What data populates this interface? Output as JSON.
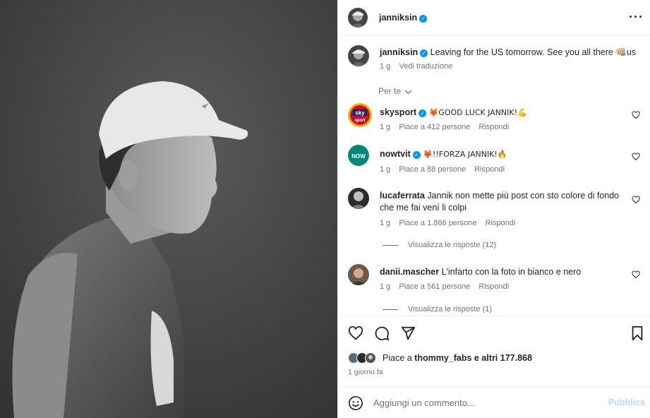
{
  "post": {
    "username": "janniksin",
    "more_icon": "more-horizontal-icon",
    "caption": {
      "username": "janniksin",
      "text": "Leaving for the US tomorrow. See you all there 👊🏼us",
      "time": "1 g",
      "translate": "Vedi traduzione"
    }
  },
  "filter": {
    "label": "Per te"
  },
  "comments": [
    {
      "username": "skysport",
      "verified": true,
      "text": "🦊GOOD LUCK JANNIK!💪",
      "time": "1 g",
      "likes": "Piace a 412 persone",
      "reply": "Rispondi"
    },
    {
      "username": "nowtvit",
      "verified": true,
      "text": "🦊!!FORZA JANNIK!🔥",
      "time": "1 g",
      "likes": "Piace a 88 persone",
      "reply": "Rispondi"
    },
    {
      "username": "lucaferrata",
      "verified": false,
      "text": "Jannik non mette più post con sto colore di fondo che me fai vení li colpi",
      "time": "1 g",
      "likes": "Piace a 1.886 persone",
      "reply": "Rispondi",
      "view_replies": "Visualizza le risposte (12)"
    },
    {
      "username": "danii.mascher",
      "verified": false,
      "text": "L'infarto con la foto in bianco e nero",
      "time": "1 g",
      "likes": "Piace a 561 persone",
      "reply": "Rispondi",
      "view_replies": "Visualizza le risposte (1)"
    }
  ],
  "likes_summary": {
    "prefix": "Piace a ",
    "user": "thommy_fabs",
    "suffix": " e altri 177.868"
  },
  "timestamp": "1 giorno fa",
  "add_comment": {
    "placeholder": "Aggiungi un commento...",
    "publish": "Pubblica"
  },
  "colors": {
    "accent": "#0095f6",
    "publish_disabled": "#b3dbff",
    "muted": "#737373"
  }
}
